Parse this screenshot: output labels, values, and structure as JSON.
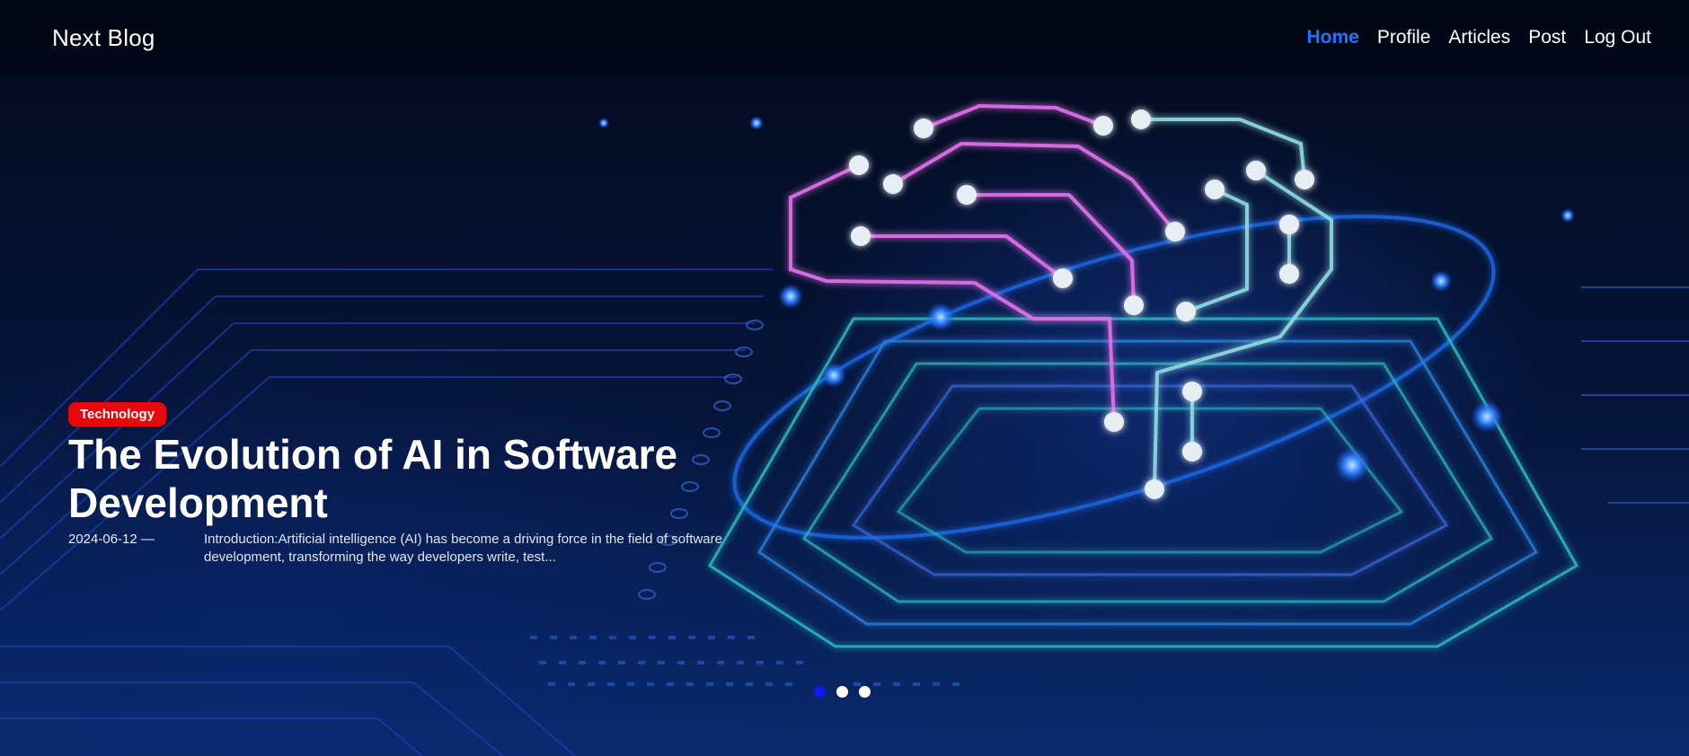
{
  "header": {
    "brand": "Next Blog",
    "nav": [
      {
        "label": "Home",
        "active": true
      },
      {
        "label": "Profile"
      },
      {
        "label": "Articles"
      },
      {
        "label": "Post"
      },
      {
        "label": "Log Out"
      }
    ]
  },
  "hero": {
    "category": "Technology",
    "title": "The Evolution of AI in Software Development",
    "date": "2024-06-12",
    "date_separator": "—",
    "excerpt": "Introduction:Artificial intelligence (AI) has become a driving force in the field of software development, transforming the way developers write, test...",
    "slides_total": 3,
    "active_slide": 1
  },
  "colors": {
    "accent": "#1e74ff",
    "badge": "#e8070b",
    "active_dot": "#0d1bea",
    "background": "#020a1e"
  }
}
